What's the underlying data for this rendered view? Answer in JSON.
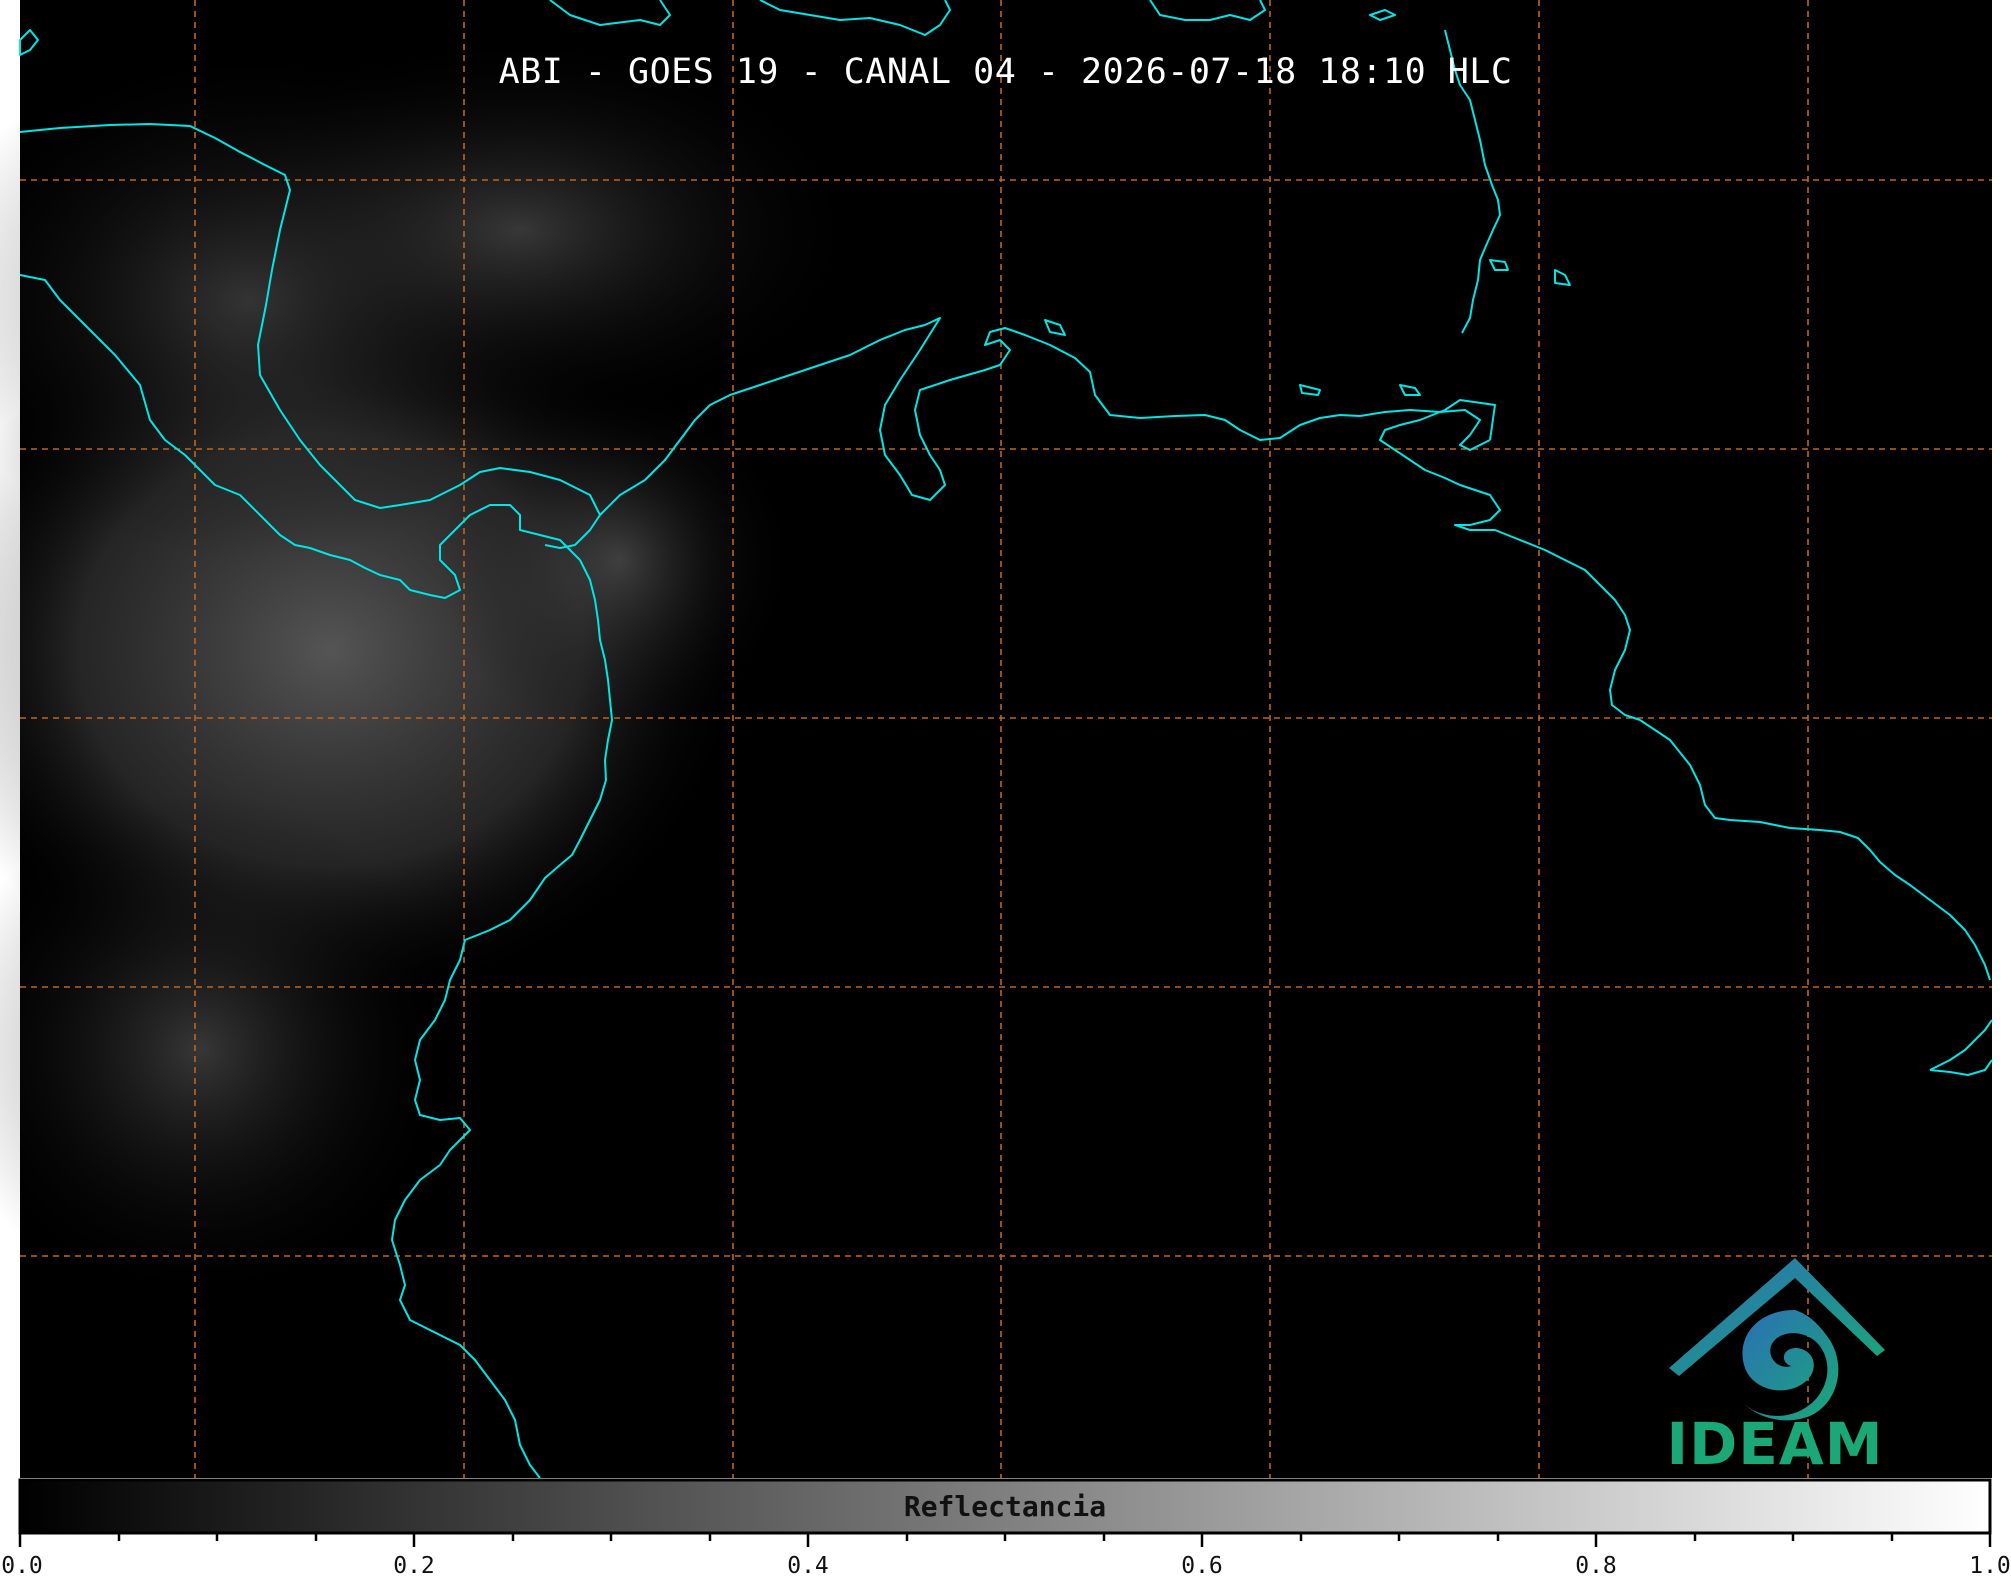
{
  "title": "ABI - GOES 19 - CANAL 04 - 2026-07-18 18:10 HLC",
  "colors": {
    "background": "#000000",
    "coastline": "#00e5e5",
    "graticule": "#c0651d",
    "logo_teal": "#1aa878",
    "logo_blue": "#2b6fb5"
  },
  "colorbar": {
    "label": "Reflectancia",
    "colormap": "grayscale",
    "range": [
      0.0,
      1.0
    ],
    "tick_labels": [
      "0.0",
      "0.2",
      "0.4",
      "0.6",
      "0.8",
      "1.0"
    ]
  },
  "logo": {
    "text": "IDEAM",
    "icon": "ideam-logo-icon"
  }
}
